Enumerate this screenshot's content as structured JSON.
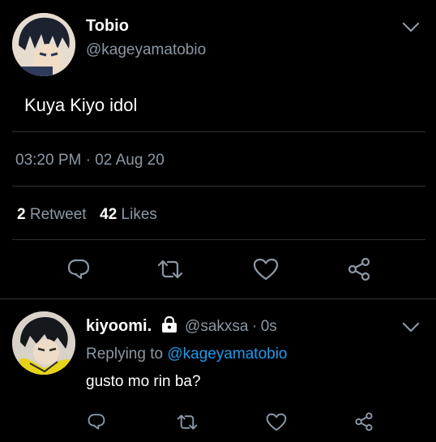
{
  "tweet": {
    "display_name": "Tobio",
    "handle": "@kageyamatobio",
    "text": "Kuya Kiyo idol",
    "time": "03:20 PM",
    "separator": "·",
    "date": "02 Aug 20",
    "retweet_count": "2",
    "retweet_label": "Retweet",
    "like_count": "42",
    "like_label": "Likes"
  },
  "reply": {
    "display_name": "kiyoomi.",
    "handle": "@sakxsa",
    "separator": "·",
    "age": "0s",
    "replying_prefix": "Replying to",
    "replying_to": "@kageyamatobio",
    "text": "gusto mo rin ba?"
  },
  "icons": {
    "reply": "reply-icon",
    "retweet": "retweet-icon",
    "like": "heart-icon",
    "share": "share-icon",
    "more": "chevron-down-icon",
    "lock": "lock-icon"
  },
  "colors": {
    "background": "#000000",
    "text": "#ffffff",
    "secondary": "#8b98a5",
    "link": "#1d9bf0",
    "divider": "#2f3336"
  }
}
